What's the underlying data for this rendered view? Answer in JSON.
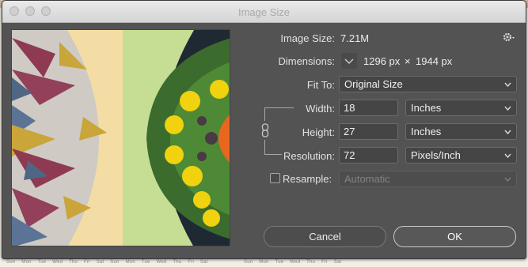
{
  "window": {
    "title": "Image Size"
  },
  "image_size": {
    "label": "Image Size:",
    "value": "7.21M"
  },
  "dimensions": {
    "label": "Dimensions:",
    "width_px": "1296 px",
    "times": "×",
    "height_px": "1944 px"
  },
  "fit_to": {
    "label": "Fit To:",
    "value": "Original Size"
  },
  "width": {
    "label": "Width:",
    "value": "18",
    "unit": "Inches"
  },
  "height": {
    "label": "Height:",
    "value": "27",
    "unit": "Inches"
  },
  "resolution": {
    "label": "Resolution:",
    "value": "72",
    "unit": "Pixels/Inch"
  },
  "resample": {
    "label": "Resample:",
    "checked": false,
    "method": "Automatic"
  },
  "buttons": {
    "cancel": "Cancel",
    "ok": "OK"
  },
  "icons": {
    "settings": "gear-icon",
    "dimensions_toggle": "chevron-down-icon",
    "constrain": "chain-link-icon",
    "select_arrow": "chevron-updown-icon"
  },
  "backdrop": {
    "calendar_days_left": [
      "Sun",
      "Mon",
      "Tue",
      "Wed",
      "Thu",
      "Fri",
      "Sat",
      "Sun",
      "Mon",
      "Tue",
      "Wed",
      "Thu",
      "Fri",
      "Sat"
    ],
    "calendar_days_right": [
      "Sun",
      "Mon",
      "Tue",
      "Wed",
      "Thu",
      "Fri",
      "Sat"
    ]
  },
  "colors": {
    "dialog_bg": "#535353",
    "preview_left_bg": "#f4dca5",
    "preview_right_bg": "#c5de94"
  }
}
